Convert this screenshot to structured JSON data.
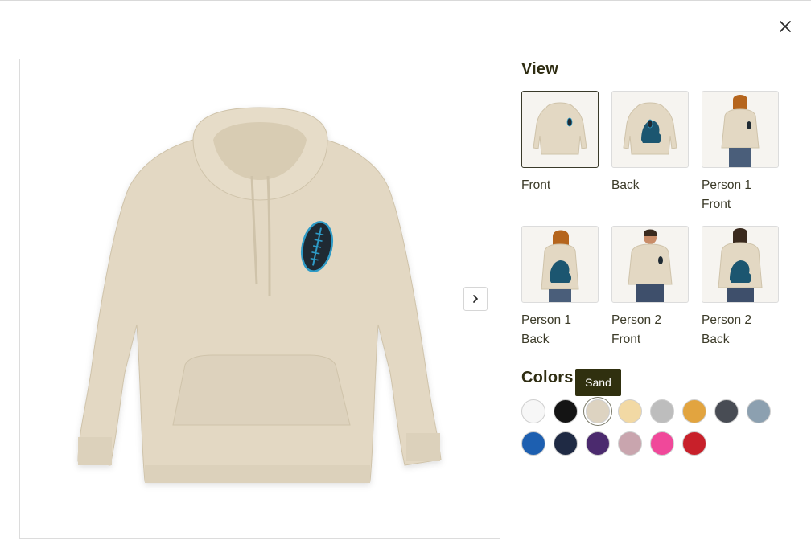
{
  "modal": {
    "close_icon": "close-icon"
  },
  "gallery": {
    "next_icon": "chevron-right-icon",
    "product_color": "#e3d8c3",
    "ball_color": "#2e9bc7"
  },
  "view": {
    "title": "View",
    "items": [
      {
        "label": "Front",
        "selected": true
      },
      {
        "label": "Back",
        "selected": false
      },
      {
        "label": "Person 1 Front",
        "selected": false
      },
      {
        "label": "Person 1 Back",
        "selected": false
      },
      {
        "label": "Person 2 Front",
        "selected": false
      },
      {
        "label": "Person 2 Back",
        "selected": false
      }
    ]
  },
  "colors": {
    "title": "Colors",
    "tooltip": "Sand",
    "swatches": [
      {
        "name": "White",
        "hex": "#f7f7f7"
      },
      {
        "name": "Black",
        "hex": "#141414"
      },
      {
        "name": "Sand",
        "hex": "#ddd3c1",
        "selected": true
      },
      {
        "name": "Cream",
        "hex": "#f2d9a4"
      },
      {
        "name": "Heather Grey",
        "hex": "#bdbdbd"
      },
      {
        "name": "Gold",
        "hex": "#e2a43f"
      },
      {
        "name": "Charcoal",
        "hex": "#484c54"
      },
      {
        "name": "Slate Blue",
        "hex": "#8ca0b0"
      },
      {
        "name": "Royal Blue",
        "hex": "#1d5fb0"
      },
      {
        "name": "Navy",
        "hex": "#1f2a44"
      },
      {
        "name": "Purple",
        "hex": "#4b2a6e"
      },
      {
        "name": "Mauve",
        "hex": "#c9a5ae"
      },
      {
        "name": "Pink",
        "hex": "#f0489a"
      },
      {
        "name": "Red",
        "hex": "#c8202a"
      }
    ]
  }
}
